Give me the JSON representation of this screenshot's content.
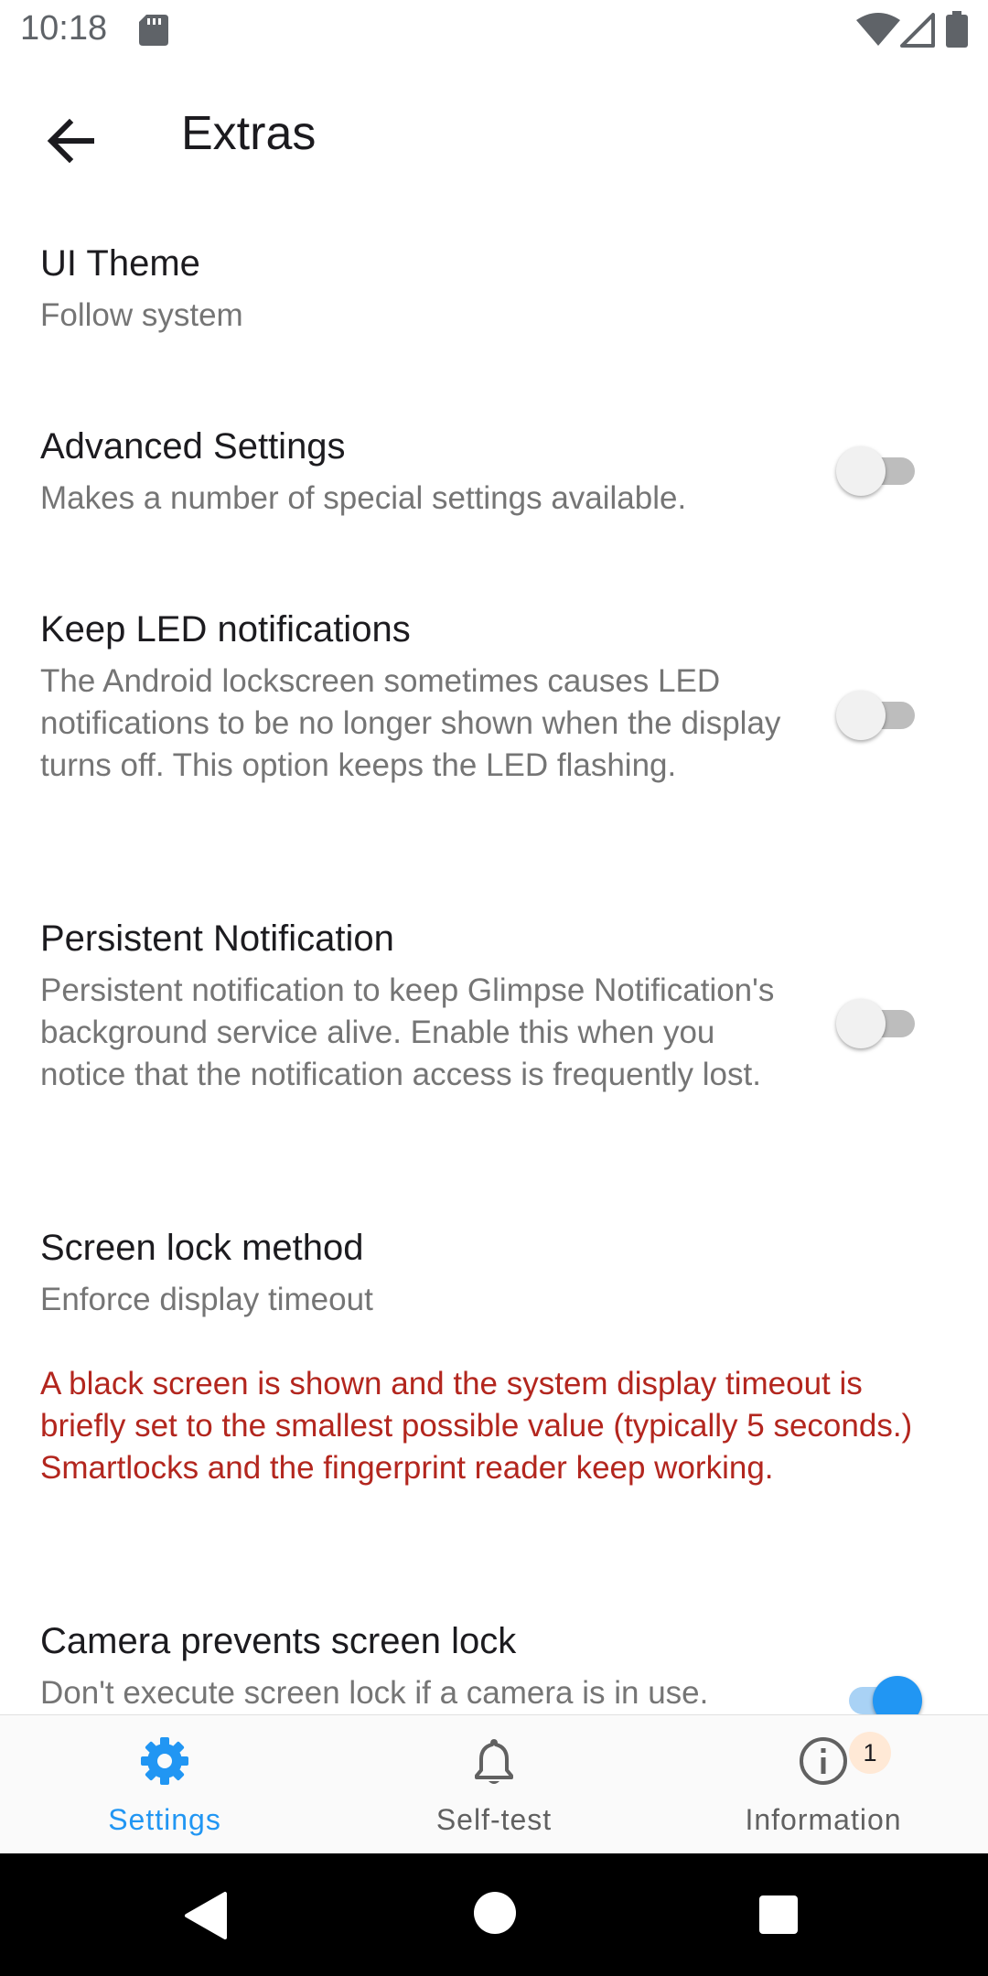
{
  "status_bar": {
    "time": "10:18",
    "icons": [
      "sd-card-icon",
      "wifi-icon",
      "signal-icon",
      "battery-icon"
    ]
  },
  "app_bar": {
    "back_icon": "arrow-back-icon",
    "title": "Extras"
  },
  "preferences": {
    "ui_theme": {
      "title": "UI Theme",
      "summary": "Follow system"
    },
    "advanced_settings": {
      "title": "Advanced Settings",
      "summary": "Makes a number of special settings available.",
      "enabled": false
    },
    "keep_led": {
      "title": "Keep LED notifications",
      "summary": "The Android lockscreen sometimes causes LED notifications to be no longer shown when the display turns off. This option keeps the LED flashing.",
      "enabled": false
    },
    "persistent_notification": {
      "title": "Persistent Notification",
      "summary": "Persistent notification to keep Glimpse Notification's background service alive. Enable this when you notice that the notification access is frequently lost.",
      "enabled": false
    },
    "screen_lock_method": {
      "title": "Screen lock method",
      "summary": "Enforce display timeout",
      "warning": "A black screen is shown and the system display timeout is briefly set to the smallest possible value (typically 5 seconds.) Smartlocks and the fingerprint reader keep working."
    },
    "camera_prevents_lock": {
      "title": "Camera prevents screen lock",
      "summary": "Don't execute screen lock if a camera is in use.",
      "enabled": true
    }
  },
  "bottom_nav": {
    "settings": {
      "label": "Settings",
      "icon": "gear-icon",
      "active": true
    },
    "self_test": {
      "label": "Self-test",
      "icon": "bell-icon"
    },
    "information": {
      "label": "Information",
      "icon": "info-icon",
      "badge": "1"
    }
  },
  "colors": {
    "accent": "#2196f3",
    "warning_text": "#b3261e",
    "secondary_text": "#757575"
  }
}
